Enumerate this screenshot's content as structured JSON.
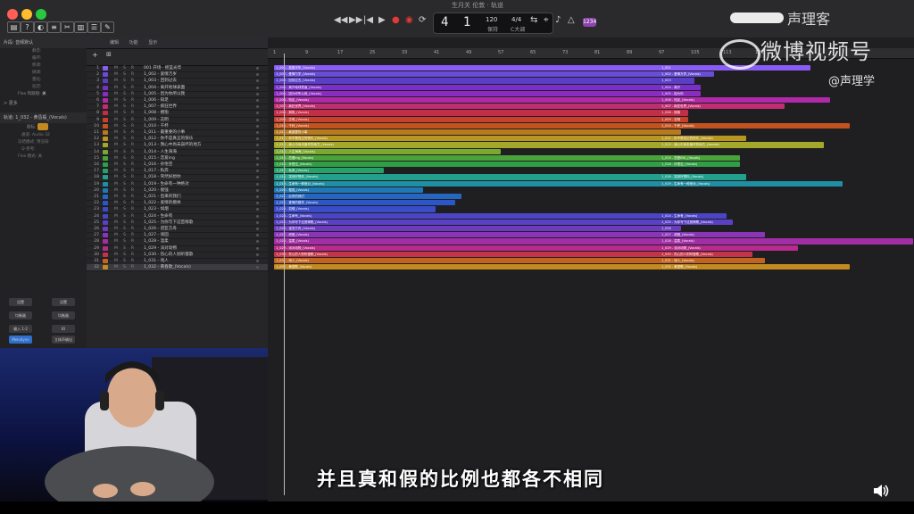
{
  "window": {
    "title": "生月关 伦敦 · 轨道"
  },
  "transport": {
    "position": "4  1",
    "tempo": "120",
    "tempo_label": "保持",
    "time_sig": "4/4",
    "key": "C大调",
    "badge": "1234"
  },
  "inspector": {
    "header": "片段: 音频默认",
    "rows": [
      "静音:",
      "循环:",
      "移调:",
      "微调:",
      "量化:",
      "延迟:"
    ],
    "flex_label": "Flex 和跟随:",
    "flex_value": "关",
    "more_label": "> 更多",
    "track_header": "轨道: 1_032 - 黄昏般_(Vocals)",
    "track_rows": [
      "图标:",
      "通道:",
      "冻结模式:",
      "Q-参考:",
      "Flex 模式:"
    ],
    "track_values": [
      "",
      "Audio 32",
      "预渲染",
      "",
      "关"
    ],
    "bottom_buttons": [
      "设置",
      "设置",
      "均衡器",
      "均衡器",
      "输入 1-2",
      "IO",
      "Melodyne",
      "立体声输出"
    ]
  },
  "tracklist": {
    "toolbar": [
      "编辑",
      "功能",
      "显示"
    ],
    "tracks": [
      {
        "num": "1",
        "name": "001 开场 · 摇篮光年",
        "color": "#8a5cf6"
      },
      {
        "num": "2",
        "name": "1_002 - 爱情万岁",
        "color": "#6a4cd9"
      },
      {
        "num": "3",
        "name": "1_003 - 回到过去",
        "color": "#5a3fc4"
      },
      {
        "num": "4",
        "name": "1_004 - 离开地球表面",
        "color": "#7b2fc9"
      },
      {
        "num": "5",
        "name": "1_005 - 因为你所以我",
        "color": "#8a2cc0"
      },
      {
        "num": "6",
        "name": "1_006 - 知足",
        "color": "#b02aa8"
      },
      {
        "num": "7",
        "name": "1_007 - 疯狂世界",
        "color": "#c02e72"
      },
      {
        "num": "8",
        "name": "1_008 - 拥抱",
        "color": "#c02e48"
      },
      {
        "num": "9",
        "name": "1_009 - 志明",
        "color": "#c8412f"
      },
      {
        "num": "10",
        "name": "1_010 - 干杯",
        "color": "#c2531f"
      },
      {
        "num": "11",
        "name": "1_011 - 最重要的小事",
        "color": "#b87a1f"
      },
      {
        "num": "12",
        "name": "1_012 - 你不是真正的快乐",
        "color": "#b89620"
      },
      {
        "num": "13",
        "name": "1_013 - 我心中尚未崩坏的地方",
        "color": "#a3a82a"
      },
      {
        "num": "14",
        "name": "1_014 - 人生海海",
        "color": "#7aa830"
      },
      {
        "num": "15",
        "name": "1_015 - 恋爱ing",
        "color": "#4aa33a"
      },
      {
        "num": "16",
        "name": "1_016 - 孙悟空",
        "color": "#2f9e44"
      },
      {
        "num": "17",
        "name": "1_017 - 私奔",
        "color": "#27a06a"
      },
      {
        "num": "18",
        "name": "1_018 - 突然好想你",
        "color": "#23a08c"
      },
      {
        "num": "19",
        "name": "1_019 - 生命有一种绝对",
        "color": "#1f8fa3"
      },
      {
        "num": "20",
        "name": "1_020 - 倔强",
        "color": "#2079b6"
      },
      {
        "num": "21",
        "name": "1_021 - 后来的我们",
        "color": "#2566c2"
      },
      {
        "num": "22",
        "name": "1_022 - 爱情的模样",
        "color": "#2c56c6"
      },
      {
        "num": "23",
        "name": "1_023 - 如烟",
        "color": "#3a4cc6"
      },
      {
        "num": "24",
        "name": "1_024 - 生命有",
        "color": "#4a45c4"
      },
      {
        "num": "25",
        "name": "1_025 - 为你写下这首情歌",
        "color": "#5a40c2"
      },
      {
        "num": "26",
        "name": "1_026 - 诺亚方舟",
        "color": "#6c3bc0"
      },
      {
        "num": "27",
        "name": "1_027 - 顽固",
        "color": "#8a34b8"
      },
      {
        "num": "28",
        "name": "1_028 - 温柔",
        "color": "#a22ea6"
      },
      {
        "num": "29",
        "name": "1_029 - 派对动物",
        "color": "#b82a8e"
      },
      {
        "num": "30",
        "name": "1_030 - 伤心的人别听慢歌",
        "color": "#c23548"
      },
      {
        "num": "31",
        "name": "1_031 - 戏人",
        "color": "#c2641f"
      },
      {
        "num": "32",
        "name": "1_032 - 黄昏歌_(Vocals)",
        "color": "#c28a1f"
      }
    ]
  },
  "ruler": {
    "marks": [
      "1",
      "9",
      "17",
      "25",
      "33",
      "41",
      "49",
      "57",
      "65",
      "73",
      "81",
      "89",
      "97",
      "105",
      "113",
      "121"
    ]
  },
  "regions": [
    {
      "track": 0,
      "start": 0.01,
      "end": 0.61,
      "label": "1_001 - 摇篮光年_(Vocals)",
      "color": "#8a5cf6",
      "r2end": 0.84,
      "label2": "1_001"
    },
    {
      "track": 1,
      "start": 0.01,
      "end": 0.61,
      "label": "1_002 - 爱情万岁_(Vocals)",
      "color": "#6a4cd9",
      "r2end": 0.69,
      "label2": "1_002 - 爱情万岁_(Vocals)"
    },
    {
      "track": 2,
      "start": 0.01,
      "end": 0.61,
      "label": "1_003 - 回到过去_(Vocals)",
      "color": "#5a3fc4",
      "r2end": 0.66,
      "label2": "1_003"
    },
    {
      "track": 3,
      "start": 0.01,
      "end": 0.61,
      "label": "1_004 - 离开地球表面_(Vocals)",
      "color": "#7b2fc9",
      "r2end": 0.67,
      "label2": "1_004 - 离开"
    },
    {
      "track": 4,
      "start": 0.01,
      "end": 0.61,
      "label": "1_005 - 因为你所以我_(Vocals)",
      "color": "#8a2cc0",
      "r2end": 0.67,
      "label2": "1_005 - 因为你"
    },
    {
      "track": 5,
      "start": 0.01,
      "end": 0.61,
      "label": "1_006 - 知足_(Vocals)",
      "color": "#b02aa8",
      "r2end": 0.87,
      "label2": "1_006 - 知足_(Vocals)"
    },
    {
      "track": 6,
      "start": 0.01,
      "end": 0.61,
      "label": "1_007 - 疯狂世界_(Vocals)",
      "color": "#c02e72",
      "r2end": 0.8,
      "label2": "1_007 - 疯狂世界_(Vocals)"
    },
    {
      "track": 7,
      "start": 0.01,
      "end": 0.61,
      "label": "1_008 - 拥抱_(Vocals)",
      "color": "#c02e48",
      "r2end": 0.65,
      "label2": "1_008 - 拥抱"
    },
    {
      "track": 8,
      "start": 0.01,
      "end": 0.61,
      "label": "1_009 - 志明_(Vocals)",
      "color": "#c8412f",
      "r2end": 0.65,
      "label2": "1_009 - 志明"
    },
    {
      "track": 9,
      "start": 0.01,
      "end": 0.61,
      "label": "1_010 - 干杯_(Vocals)",
      "color": "#c2531f",
      "r2end": 0.9,
      "label2": "1_010 - 干杯_(Vocals)"
    },
    {
      "track": 10,
      "start": 0.01,
      "end": 0.61,
      "label": "1_011 - 最重要的小事",
      "color": "#b87a1f",
      "r2end": 0.64,
      "label2": ""
    },
    {
      "track": 11,
      "start": 0.01,
      "end": 0.61,
      "label": "1_012 - 你不是真正的快乐_(Vocals)",
      "color": "#b89620",
      "r2end": 0.74,
      "label2": "1_012 - 你不是真正的快乐_(Vocals)"
    },
    {
      "track": 12,
      "start": 0.01,
      "end": 0.61,
      "label": "1_013 - 我心中尚未崩坏的地方_(Vocals)",
      "color": "#a3a82a",
      "r2end": 0.86,
      "label2": "1_013 - 我心中尚未崩坏的地方_(Vocals)"
    },
    {
      "track": 13,
      "start": 0.01,
      "end": 0.36,
      "label": "1_014 - 人生海海_(Vocals)",
      "color": "#7aa830",
      "r2end": 0.36,
      "label2": ""
    },
    {
      "track": 14,
      "start": 0.01,
      "end": 0.61,
      "label": "1_015 - 恋爱ing_(Vocals)",
      "color": "#4aa33a",
      "r2end": 0.73,
      "label2": "1_015 - 恋爱ING_(Vocals)"
    },
    {
      "track": 15,
      "start": 0.01,
      "end": 0.61,
      "label": "1_016 - 孙悟空_(Vocals)",
      "color": "#2f9e44",
      "r2end": 0.73,
      "label2": "1_016 - 孙悟空_(Vocals)"
    },
    {
      "track": 16,
      "start": 0.01,
      "end": 0.18,
      "label": "1_017 - 私奔_(Vocals)",
      "color": "#27a06a",
      "r2end": 0.18,
      "label2": ""
    },
    {
      "track": 17,
      "start": 0.01,
      "end": 0.61,
      "label": "1_018 - 突然好想你_(Vocals)",
      "color": "#23a08c",
      "r2end": 0.74,
      "label2": "1_018 - 突然好想你_(Vocals)"
    },
    {
      "track": 18,
      "start": 0.01,
      "end": 0.61,
      "label": "1_019 - 生命有一种绝对_(Vocals)",
      "color": "#1f8fa3",
      "r2end": 0.89,
      "label2": "1_019 - 生命有一种绝对_(Vocals)"
    },
    {
      "track": 19,
      "start": 0.01,
      "end": 0.24,
      "label": "1_020 - 倔强_(Vocals)",
      "color": "#2079b6",
      "r2end": 0.24,
      "label2": ""
    },
    {
      "track": 20,
      "start": 0.01,
      "end": 0.3,
      "label": "1_021 - 后来的我们",
      "color": "#2566c2",
      "r2end": 0.3,
      "label2": ""
    },
    {
      "track": 21,
      "start": 0.01,
      "end": 0.29,
      "label": "1_022 - 爱情的模样_(Vocals)",
      "color": "#2c56c6",
      "r2end": 0.29,
      "label2": ""
    },
    {
      "track": 22,
      "start": 0.01,
      "end": 0.26,
      "label": "1_023 - 如烟_(Vocals)",
      "color": "#3a4cc6",
      "r2end": 0.26,
      "label2": ""
    },
    {
      "track": 23,
      "start": 0.01,
      "end": 0.61,
      "label": "1_024 - 生命有_(Vocals)",
      "color": "#4a45c4",
      "r2end": 0.71,
      "label2": "1_024 - 生命有_(Vocals)"
    },
    {
      "track": 24,
      "start": 0.01,
      "end": 0.61,
      "label": "1_025 - 为你写下这首情歌_(Vocals)",
      "color": "#5a40c2",
      "r2end": 0.72,
      "label2": "1_025 - 为你写下这首情歌_(Vocals)"
    },
    {
      "track": 25,
      "start": 0.01,
      "end": 0.61,
      "label": "1_026 - 诺亚方舟_(Vocals)",
      "color": "#6c3bc0",
      "r2end": 0.64,
      "label2": "1_026"
    },
    {
      "track": 26,
      "start": 0.01,
      "end": 0.61,
      "label": "1_027 - 顽固_(Vocals)",
      "color": "#8a34b8",
      "r2end": 0.77,
      "label2": "1_027 - 顽固_(Vocals)"
    },
    {
      "track": 27,
      "start": 0.01,
      "end": 0.61,
      "label": "1_028 - 温柔_(Vocals)",
      "color": "#a22ea6",
      "r2end": 1.0,
      "label2": "1_028 - 温柔_(Vocals)"
    },
    {
      "track": 28,
      "start": 0.01,
      "end": 0.61,
      "label": "1_029 - 派对动物_(Vocals)",
      "color": "#b82a8e",
      "r2end": 0.82,
      "label2": "1_029 - 派对动物_(Vocals)"
    },
    {
      "track": 29,
      "start": 0.01,
      "end": 0.61,
      "label": "1_030 - 伤心的人别听慢歌_(Vocals)",
      "color": "#c23548",
      "r2end": 0.75,
      "label2": "1_030 - 伤心的人别听慢歌_(Vocals)"
    },
    {
      "track": 30,
      "start": 0.01,
      "end": 0.61,
      "label": "1_031 - 戏人_(Vocals)",
      "color": "#c2641f",
      "r2end": 0.77,
      "label2": "1_031 - 戏人_(Vocals)"
    },
    {
      "track": 31,
      "start": 0.01,
      "end": 0.61,
      "label": "1_032 - 黄昏歌_(Vocals)",
      "color": "#c28a1f",
      "r2end": 0.9,
      "label2": "1_032 - 黄昏歌_(Vocals)"
    }
  ],
  "overlay": {
    "subtitle": "并且真和假的比例也都各不相同",
    "watermark_main": "微博视频号",
    "watermark_handle": "@声理学",
    "watermark_top": "声理客"
  }
}
